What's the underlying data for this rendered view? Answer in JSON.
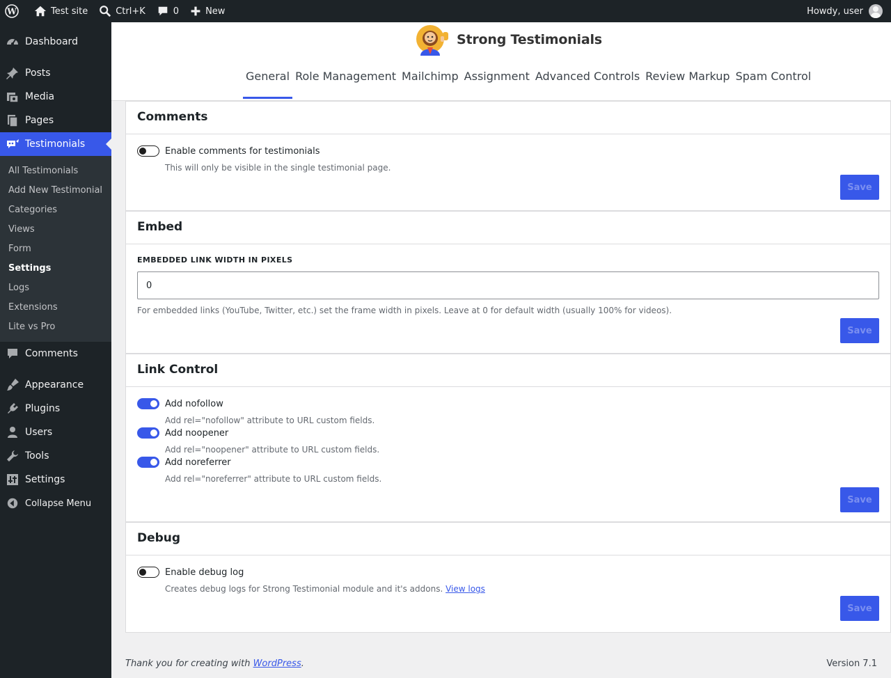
{
  "adminbar": {
    "site_name": "Test site",
    "search_shortcut": "Ctrl+K",
    "comments_count": "0",
    "new_label": "New",
    "greeting": "Howdy, user"
  },
  "sidebar": {
    "items": [
      {
        "label": "Dashboard",
        "icon": "dashboard-icon"
      },
      {
        "label": "Posts",
        "icon": "pin-icon"
      },
      {
        "label": "Media",
        "icon": "media-icon"
      },
      {
        "label": "Pages",
        "icon": "pages-icon"
      },
      {
        "label": "Testimonials",
        "icon": "testimonials-icon"
      },
      {
        "label": "Comments",
        "icon": "comment-icon"
      },
      {
        "label": "Appearance",
        "icon": "brush-icon"
      },
      {
        "label": "Plugins",
        "icon": "plugin-icon"
      },
      {
        "label": "Users",
        "icon": "user-icon"
      },
      {
        "label": "Tools",
        "icon": "wrench-icon"
      },
      {
        "label": "Settings",
        "icon": "settings-icon"
      },
      {
        "label": "Collapse Menu",
        "icon": "collapse-icon"
      }
    ],
    "submenu": [
      "All Testimonials",
      "Add New Testimonial",
      "Categories",
      "Views",
      "Form",
      "Settings",
      "Logs",
      "Extensions",
      "Lite vs Pro"
    ]
  },
  "brand": {
    "name": "Strong Testimonials"
  },
  "tabs": [
    "General",
    "Role Management",
    "Mailchimp",
    "Assignment",
    "Advanced Controls",
    "Review Markup",
    "Spam Control"
  ],
  "comments_panel": {
    "title": "Comments",
    "toggle_label": "Enable comments for testimonials",
    "toggle_on": false,
    "help": "This will only be visible in the single testimonial page.",
    "save": "Save"
  },
  "embed_panel": {
    "title": "Embed",
    "field_label": "Embedded Link Width In Pixels",
    "field_value": "0",
    "help": "For embedded links (YouTube, Twitter, etc.) set the frame width in pixels. Leave at 0 for default width (usually 100% for videos).",
    "save": "Save"
  },
  "link_panel": {
    "title": "Link Control",
    "options": [
      {
        "label": "Add nofollow",
        "help": "Add rel=\"nofollow\" attribute to URL custom fields.",
        "on": true
      },
      {
        "label": "Add noopener",
        "help": "Add rel=\"noopener\" attribute to URL custom fields.",
        "on": true
      },
      {
        "label": "Add noreferrer",
        "help": "Add rel=\"noreferrer\" attribute to URL custom fields.",
        "on": true
      }
    ],
    "save": "Save"
  },
  "debug_panel": {
    "title": "Debug",
    "toggle_label": "Enable debug log",
    "toggle_on": false,
    "help": "Creates debug logs for Strong Testimonial module and it's addons.",
    "link": "View logs",
    "save": "Save"
  },
  "footer": {
    "thanks_prefix": "Thank you for creating with ",
    "thanks_link": "WordPress",
    "thanks_suffix": ".",
    "version": "Version 7.1"
  },
  "colors": {
    "accent": "#3858e9",
    "adminbar_bg": "#1d2327",
    "page_bg": "#f0f0f1"
  }
}
